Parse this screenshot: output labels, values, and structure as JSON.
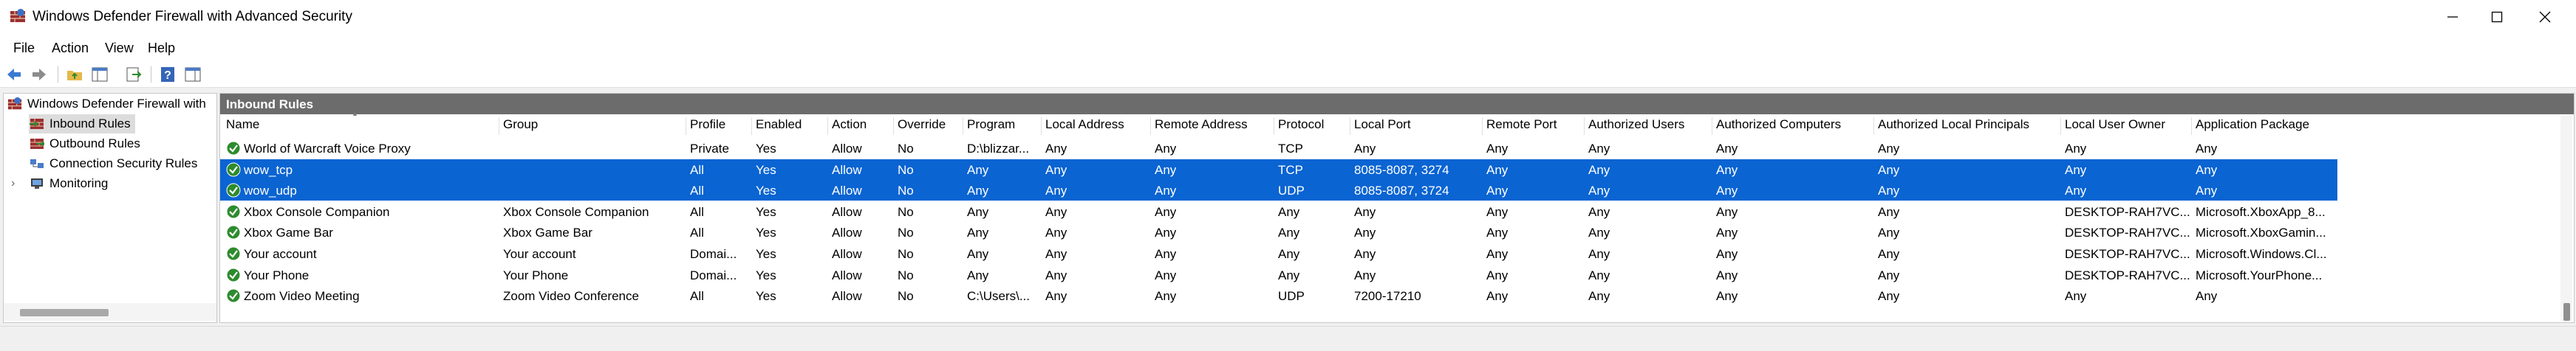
{
  "window": {
    "title": "Windows Defender Firewall with Advanced Security",
    "icons": {
      "app": "firewall-app-icon",
      "minimize": "minimize-icon",
      "maximize": "maximize-icon",
      "close": "close-icon"
    }
  },
  "menu": {
    "items": [
      "File",
      "Action",
      "View",
      "Help"
    ]
  },
  "toolbar": {
    "buttons": [
      "back-arrow-icon",
      "forward-arrow-icon",
      "folder-up-icon",
      "show-hide-tree-icon",
      "export-list-icon",
      "help-icon",
      "properties-pane-icon"
    ]
  },
  "tree": {
    "root": "Windows Defender Firewall with",
    "items": [
      {
        "label": "Inbound Rules",
        "icon": "inbound-rules-icon",
        "selected": true
      },
      {
        "label": "Outbound Rules",
        "icon": "outbound-rules-icon",
        "selected": false
      },
      {
        "label": "Connection Security Rules",
        "icon": "connection-security-icon",
        "selected": false
      },
      {
        "label": "Monitoring",
        "icon": "monitoring-icon",
        "selected": false,
        "expander": "›"
      }
    ]
  },
  "list": {
    "header": "Inbound Rules",
    "columns": [
      "Name",
      "Group",
      "Profile",
      "Enabled",
      "Action",
      "Override",
      "Program",
      "Local Address",
      "Remote Address",
      "Protocol",
      "Local Port",
      "Remote Port",
      "Authorized Users",
      "Authorized Computers",
      "Authorized Local Principals",
      "Local User Owner",
      "Application Package"
    ],
    "rows": [
      {
        "selected": false,
        "cells": [
          "World of Warcraft Voice Proxy",
          "",
          "Private",
          "Yes",
          "Allow",
          "No",
          "D:\\blizzar...",
          "Any",
          "Any",
          "TCP",
          "Any",
          "Any",
          "Any",
          "Any",
          "Any",
          "Any",
          "Any"
        ]
      },
      {
        "selected": true,
        "cells": [
          "wow_tcp",
          "",
          "All",
          "Yes",
          "Allow",
          "No",
          "Any",
          "Any",
          "Any",
          "TCP",
          "8085-8087, 3274",
          "Any",
          "Any",
          "Any",
          "Any",
          "Any",
          "Any"
        ]
      },
      {
        "selected": true,
        "cells": [
          "wow_udp",
          "",
          "All",
          "Yes",
          "Allow",
          "No",
          "Any",
          "Any",
          "Any",
          "UDP",
          "8085-8087, 3724",
          "Any",
          "Any",
          "Any",
          "Any",
          "Any",
          "Any"
        ]
      },
      {
        "selected": false,
        "cells": [
          "Xbox Console Companion",
          "Xbox Console Companion",
          "All",
          "Yes",
          "Allow",
          "No",
          "Any",
          "Any",
          "Any",
          "Any",
          "Any",
          "Any",
          "Any",
          "Any",
          "Any",
          "DESKTOP-RAH7VC...",
          "Microsoft.XboxApp_8..."
        ]
      },
      {
        "selected": false,
        "cells": [
          "Xbox Game Bar",
          "Xbox Game Bar",
          "All",
          "Yes",
          "Allow",
          "No",
          "Any",
          "Any",
          "Any",
          "Any",
          "Any",
          "Any",
          "Any",
          "Any",
          "Any",
          "DESKTOP-RAH7VC...",
          "Microsoft.XboxGamin..."
        ]
      },
      {
        "selected": false,
        "cells": [
          "Your account",
          "Your account",
          "Domai...",
          "Yes",
          "Allow",
          "No",
          "Any",
          "Any",
          "Any",
          "Any",
          "Any",
          "Any",
          "Any",
          "Any",
          "Any",
          "DESKTOP-RAH7VC...",
          "Microsoft.Windows.Cl..."
        ]
      },
      {
        "selected": false,
        "cells": [
          "Your Phone",
          "Your Phone",
          "Domai...",
          "Yes",
          "Allow",
          "No",
          "Any",
          "Any",
          "Any",
          "Any",
          "Any",
          "Any",
          "Any",
          "Any",
          "Any",
          "DESKTOP-RAH7VC...",
          "Microsoft.YourPhone..."
        ]
      },
      {
        "selected": false,
        "cells": [
          "Zoom Video Meeting",
          "Zoom Video Conference",
          "All",
          "Yes",
          "Allow",
          "No",
          "C:\\Users\\...",
          "Any",
          "Any",
          "UDP",
          "7200-17210",
          "Any",
          "Any",
          "Any",
          "Any",
          "Any",
          "Any"
        ]
      }
    ]
  },
  "colors": {
    "selection": "#0a64d2",
    "pane_header": "#6c6c6c",
    "rule_enabled": "#2e8b2e"
  }
}
